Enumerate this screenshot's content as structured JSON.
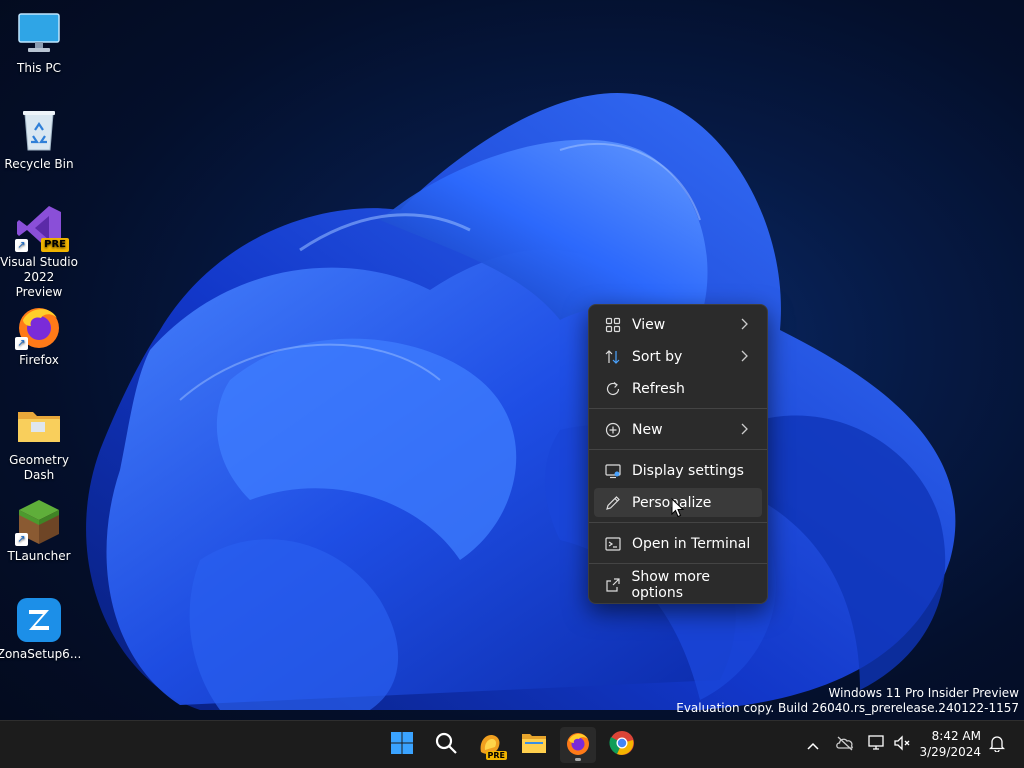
{
  "desktop": {
    "icons": [
      {
        "label": "This PC",
        "icon": "monitor-icon"
      },
      {
        "label": "Recycle Bin",
        "icon": "recycle-bin-icon"
      },
      {
        "label": "Visual Studio 2022 Preview",
        "icon": "visual-studio-icon",
        "badge": "PRE"
      },
      {
        "label": "Firefox",
        "icon": "firefox-icon"
      },
      {
        "label": "Geometry Dash",
        "icon": "folder-icon"
      },
      {
        "label": "TLauncher",
        "icon": "minecraft-grass-block-icon"
      },
      {
        "label": "ZonaSetup6...",
        "icon": "zona-icon"
      }
    ]
  },
  "context_menu": {
    "items": [
      {
        "label": "View",
        "icon": "grid-view-icon",
        "submenu": true
      },
      {
        "label": "Sort by",
        "icon": "sort-icon",
        "submenu": true
      },
      {
        "label": "Refresh",
        "icon": "refresh-icon",
        "submenu": false
      },
      {
        "label": "New",
        "icon": "plus-circle-icon",
        "submenu": true
      },
      {
        "label": "Display settings",
        "icon": "display-icon",
        "submenu": false
      },
      {
        "label": "Personalize",
        "icon": "pen-icon",
        "submenu": false,
        "hovered": true
      },
      {
        "label": "Open in Terminal",
        "icon": "terminal-icon",
        "submenu": false
      },
      {
        "label": "Show more options",
        "icon": "share-icon",
        "submenu": false
      }
    ]
  },
  "watermark": {
    "line1": "Windows 11 Pro Insider Preview",
    "line2": "Evaluation copy. Build 26040.rs_prerelease.240122-1157"
  },
  "taskbar": {
    "apps": [
      {
        "name": "Start",
        "icon": "windows-start-icon"
      },
      {
        "name": "Search",
        "icon": "search-icon"
      },
      {
        "name": "Copilot",
        "icon": "copilot-pre-icon",
        "badge": "PRE"
      },
      {
        "name": "File Explorer",
        "icon": "folder-icon"
      },
      {
        "name": "Firefox",
        "icon": "firefox-icon",
        "running": true
      },
      {
        "name": "Chrome",
        "icon": "chrome-icon"
      }
    ],
    "tray": [
      "chevron-up-icon",
      "onedrive-offline-icon",
      "network-icon",
      "volume-muted-icon",
      "notification-bell-icon"
    ],
    "time": "8:42 AM",
    "date": "3/29/2024"
  },
  "colors": {
    "accent": "#1a5cff",
    "menu_bg": "#2b2b2b",
    "taskbar_bg": "#1c1c1c"
  }
}
